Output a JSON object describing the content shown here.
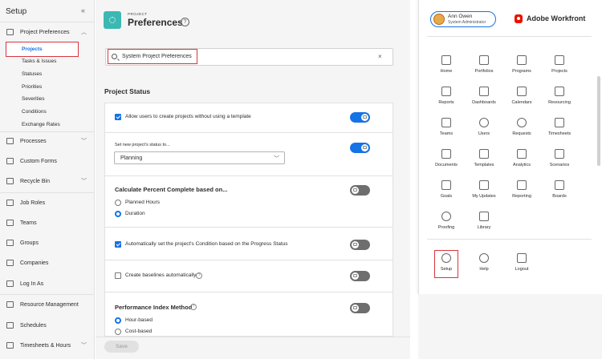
{
  "sidebar": {
    "title": "Setup",
    "collapse_icon": "«",
    "items": [
      {
        "label": "Project Preferences",
        "icon": "sliders-icon",
        "expanded": true
      },
      {
        "label": "Processes",
        "icon": "processes-icon"
      },
      {
        "label": "Custom Forms",
        "icon": "form-icon"
      },
      {
        "label": "Recycle Bin",
        "icon": "trash-icon"
      },
      {
        "label": "Job Roles",
        "icon": "job-roles-icon"
      },
      {
        "label": "Teams",
        "icon": "teams-icon"
      },
      {
        "label": "Groups",
        "icon": "groups-icon"
      },
      {
        "label": "Companies",
        "icon": "companies-icon"
      },
      {
        "label": "Log In As",
        "icon": "login-icon"
      },
      {
        "label": "Resource Management",
        "icon": "resource-icon"
      },
      {
        "label": "Schedules",
        "icon": "calendar-icon"
      },
      {
        "label": "Timesheets & Hours",
        "icon": "timesheet-icon"
      }
    ],
    "subitems": [
      "Projects",
      "Tasks & Issues",
      "Statuses",
      "Priorities",
      "Severities",
      "Conditions",
      "Exchange Rates"
    ]
  },
  "header": {
    "kicker": "PROJECT",
    "title": "Preferences",
    "help": "?"
  },
  "search": {
    "value": "System Project Preferences",
    "clear": "×"
  },
  "section": {
    "title": "Project Status",
    "allow_no_template": {
      "label": "Allow users to create projects without using a template",
      "checked": true,
      "toggle": true
    },
    "status_to": {
      "label": "Set new project's status to...",
      "value": "Planning",
      "toggle": true
    },
    "percent_complete": {
      "label": "Calculate Percent Complete based on...",
      "options": [
        "Planned Hours",
        "Duration"
      ],
      "selected": "Duration",
      "toggle": false
    },
    "auto_condition": {
      "label": "Automatically set the project's Condition based on the Progress Status",
      "checked": true,
      "toggle": false
    },
    "baselines": {
      "label": "Create baselines automatically",
      "checked": false,
      "toggle": false
    },
    "performance": {
      "label": "Performance Index Method",
      "options": [
        "Hour-based",
        "Cost-based"
      ],
      "selected": "Hour-based",
      "toggle": false
    }
  },
  "footer": {
    "save_label": "Save"
  },
  "menu": {
    "user_name": "Ann Owen",
    "user_role": "System Administrator",
    "brand": "Adobe Workfront",
    "tiles": [
      {
        "label": "Home",
        "icon": "home-icon"
      },
      {
        "label": "Portfolios",
        "icon": "portfolios-icon"
      },
      {
        "label": "Programs",
        "icon": "programs-icon"
      },
      {
        "label": "Projects",
        "icon": "projects-icon"
      },
      {
        "label": "Reports",
        "icon": "reports-icon"
      },
      {
        "label": "Dashboards",
        "icon": "dashboards-icon"
      },
      {
        "label": "Calendars",
        "icon": "calendars-icon"
      },
      {
        "label": "Resourcing",
        "icon": "resourcing-icon"
      },
      {
        "label": "Teams",
        "icon": "teams-icon"
      },
      {
        "label": "Users",
        "icon": "users-icon"
      },
      {
        "label": "Requests",
        "icon": "requests-icon"
      },
      {
        "label": "Timesheets",
        "icon": "timesheets-icon"
      },
      {
        "label": "Documents",
        "icon": "documents-icon"
      },
      {
        "label": "Templates",
        "icon": "templates-icon"
      },
      {
        "label": "Analytics",
        "icon": "analytics-icon"
      },
      {
        "label": "Scenarios",
        "icon": "scenarios-icon"
      },
      {
        "label": "Goals",
        "icon": "goals-icon"
      },
      {
        "label": "My Updates",
        "icon": "my-updates-icon"
      },
      {
        "label": "Reporting",
        "icon": "reporting-icon"
      },
      {
        "label": "Boards",
        "icon": "boards-icon"
      },
      {
        "label": "Proofing",
        "icon": "proofing-icon"
      },
      {
        "label": "Library",
        "icon": "library-icon"
      }
    ],
    "bottom": [
      {
        "label": "Setup",
        "icon": "gear-icon"
      },
      {
        "label": "Help",
        "icon": "help-icon"
      },
      {
        "label": "Logout",
        "icon": "logout-icon"
      }
    ]
  }
}
